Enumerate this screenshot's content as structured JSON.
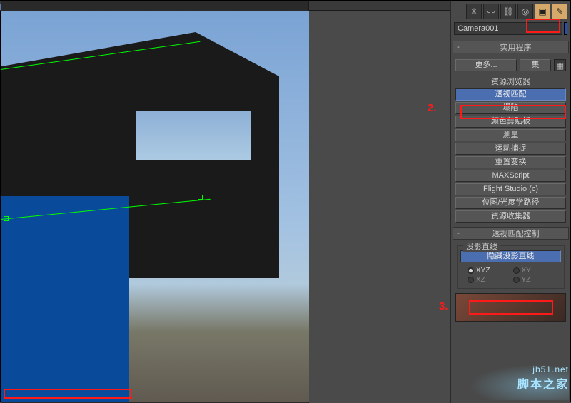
{
  "camera_name": "Camera001",
  "rollouts": {
    "utilities": {
      "title": "实用程序",
      "more": "更多...",
      "sets": "集",
      "asset_browser": "资源浏览器",
      "perspective_match": "透视匹配",
      "collapse": "塌陷",
      "color_clipboard": "颜色剪贴板",
      "measure": "测量",
      "motion_capture": "运动捕捉",
      "reset_xform": "重置变换",
      "maxscript": "MAXScript",
      "flight_studio": "Flight Studio (c)",
      "bitmap_path": "位图/光度学路径",
      "asset_collector": "资源收集器"
    },
    "pm_control": {
      "title": "透视匹配控制",
      "group_label": "没影直线",
      "hide_lines": "隐藏没影直线",
      "radios": {
        "xyz": "XYZ",
        "xy": "XY",
        "xz": "XZ",
        "yz": "YZ"
      }
    }
  },
  "annotations": {
    "two": "2.",
    "three": "3."
  },
  "watermark": {
    "url": "jb51.net",
    "cn": "脚本之家"
  },
  "icons": {
    "create": "✳",
    "modify": "〰",
    "hierarchy": "⛓",
    "motion": "◎",
    "display": "▣",
    "utilities": "✎",
    "config": "▦"
  }
}
